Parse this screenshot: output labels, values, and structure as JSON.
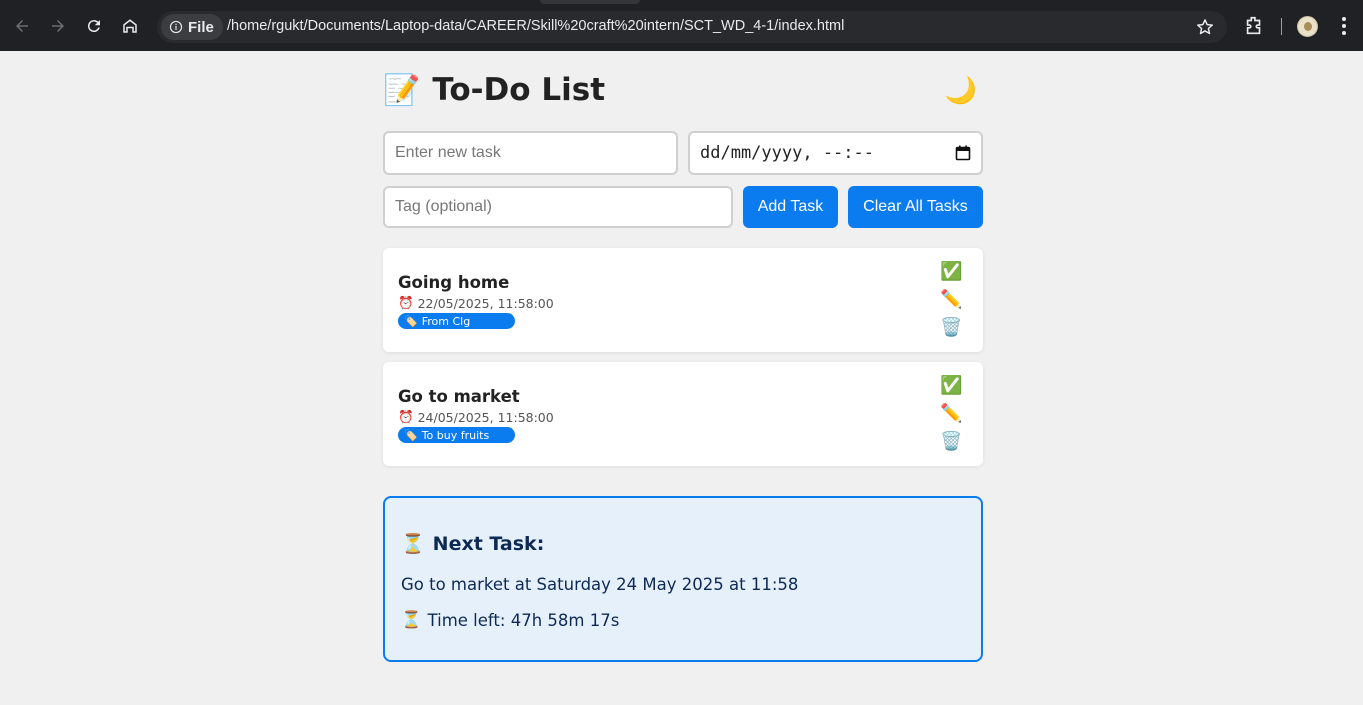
{
  "browser": {
    "site_label": "File",
    "url": "/home/rgukt/Documents/Laptop-data/CAREER/Skill%20craft%20intern/SCT_WD_4-1/index.html"
  },
  "app": {
    "title_emoji": "📝",
    "title": "To-Do List",
    "theme_icon": "🌙",
    "task_placeholder": "Enter new task",
    "date_placeholder": "dd/mm/yyyy, --:--",
    "tag_placeholder": "Tag (optional)",
    "add_label": "Add Task",
    "clear_label": "Clear All Tasks"
  },
  "tasks": [
    {
      "name": "Going home",
      "clock_icon": "⏰",
      "datetime": "22/05/2025, 11:58:00",
      "tag_icon": "🏷️",
      "tag": "From Clg"
    },
    {
      "name": "Go to market",
      "clock_icon": "⏰",
      "datetime": "24/05/2025, 11:58:00",
      "tag_icon": "🏷️",
      "tag": "To buy fruits"
    }
  ],
  "actions": {
    "done": "✅",
    "edit": "✏️",
    "delete": "🗑️"
  },
  "next": {
    "icon": "⏳",
    "title": "Next Task:",
    "text": "Go to market at Saturday 24 May 2025 at 11:58",
    "time_left": "Time left: 47h 58m 17s"
  },
  "colors": {
    "accent": "#0a7cf0",
    "chrome": "#202124",
    "next_bg": "#e6f0fb"
  }
}
